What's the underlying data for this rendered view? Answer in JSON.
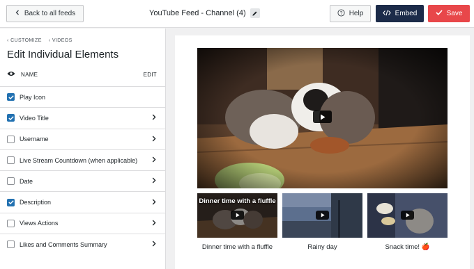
{
  "topbar": {
    "back_label": "Back to all feeds",
    "title": "YouTube Feed - Channel (4)",
    "help_label": "Help",
    "embed_label": "Embed",
    "save_label": "Save"
  },
  "sidebar": {
    "crumb_customize": "CUSTOMIZE",
    "crumb_videos": "VIDEOS",
    "heading": "Edit Individual Elements",
    "name_label": "NAME",
    "edit_label": "EDIT",
    "items": [
      {
        "label": "Play Icon",
        "checked": true
      },
      {
        "label": "Video Title",
        "checked": true
      },
      {
        "label": "Username",
        "checked": false
      },
      {
        "label": "Live Stream Countdown (when applicable)",
        "checked": false
      },
      {
        "label": "Date",
        "checked": false
      },
      {
        "label": "Description",
        "checked": true
      },
      {
        "label": "Views Actions",
        "checked": false
      },
      {
        "label": "Likes and Comments Summary",
        "checked": false
      }
    ]
  },
  "preview": {
    "videos": [
      {
        "caption": "Dinner time with a fluffle",
        "overlay_title": "Dinner time with a fluffle"
      },
      {
        "caption": "Rainy day"
      },
      {
        "caption": "Snack time! 🍎"
      }
    ]
  },
  "colors": {
    "accent_blue": "#2271b1",
    "embed_bg": "#1c2b49",
    "save_bg": "#e8474a"
  }
}
